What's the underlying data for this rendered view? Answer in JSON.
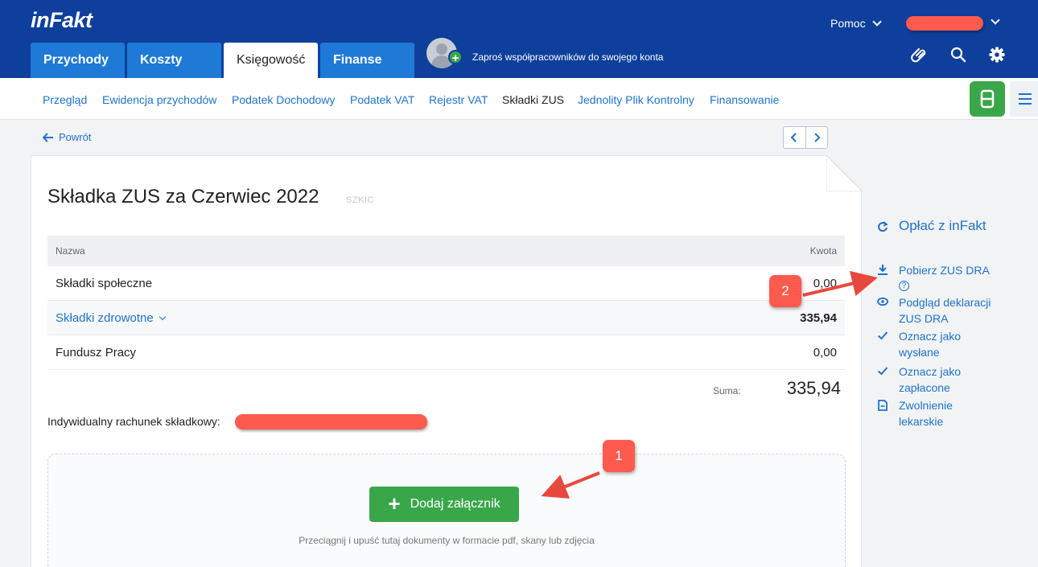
{
  "brand": {
    "logo": "inFakt"
  },
  "header": {
    "help_label": "Pomoc",
    "invite_text": "Zaproś współpracowników do swojego konta",
    "tabs": [
      {
        "label": "Przychody"
      },
      {
        "label": "Koszty"
      },
      {
        "label": "Księgowość"
      },
      {
        "label": "Finanse"
      }
    ],
    "active_tab": "Księgowość"
  },
  "subnav": {
    "items": [
      {
        "label": "Przegląd"
      },
      {
        "label": "Ewidencja przychodów"
      },
      {
        "label": "Podatek Dochodowy"
      },
      {
        "label": "Podatek VAT"
      },
      {
        "label": "Rejestr VAT"
      },
      {
        "label": "Składki ZUS"
      },
      {
        "label": "Jednolity Plik Kontrolny"
      },
      {
        "label": "Finansowanie"
      }
    ],
    "active": "Składki ZUS"
  },
  "back_label": "Powrót",
  "document": {
    "title": "Składka ZUS za Czerwiec 2022",
    "status": "SZKIC",
    "table": {
      "columns": [
        "Nazwa",
        "Kwota"
      ],
      "rows": [
        {
          "name": "Składki społeczne",
          "amount": "0,00"
        },
        {
          "name": "Składki zdrowotne",
          "amount": "335,94"
        },
        {
          "name": "Fundusz Pracy",
          "amount": "0,00"
        }
      ]
    },
    "sum_label": "Suma:",
    "sum_value": "335,94",
    "account_label": "Indywidualny rachunek składkowy:"
  },
  "attachments": {
    "button_label": "Dodaj załącznik",
    "hint": "Przeciągnij i upuść tutaj dokumenty w formacie pdf, skany lub zdjęcia"
  },
  "actions": {
    "pay": "Opłać z inFakt",
    "download": "Pobierz ZUS DRA",
    "preview": "Podgląd deklaracji ZUS DRA",
    "mark_sent": "Oznacz jako wysłane",
    "mark_paid": "Oznacz jako zapłacone",
    "sick_leave": "Zwolnienie lekarskie"
  },
  "callouts": {
    "first": "1",
    "second": "2"
  },
  "colors": {
    "header_bg": "#0e3f9c",
    "tab_bg": "#1e7ad6",
    "link": "#1e73c9",
    "green": "#3aa64a",
    "annotation_red": "#ff5a4e"
  },
  "icons": [
    "paperclip-icon",
    "search-icon",
    "gear-icon",
    "print-icon",
    "hamburger-icon",
    "arrow-left-icon",
    "chevron-left-icon",
    "chevron-right-icon",
    "refresh-icon",
    "download-icon",
    "eye-icon",
    "check-icon",
    "document-icon"
  ]
}
